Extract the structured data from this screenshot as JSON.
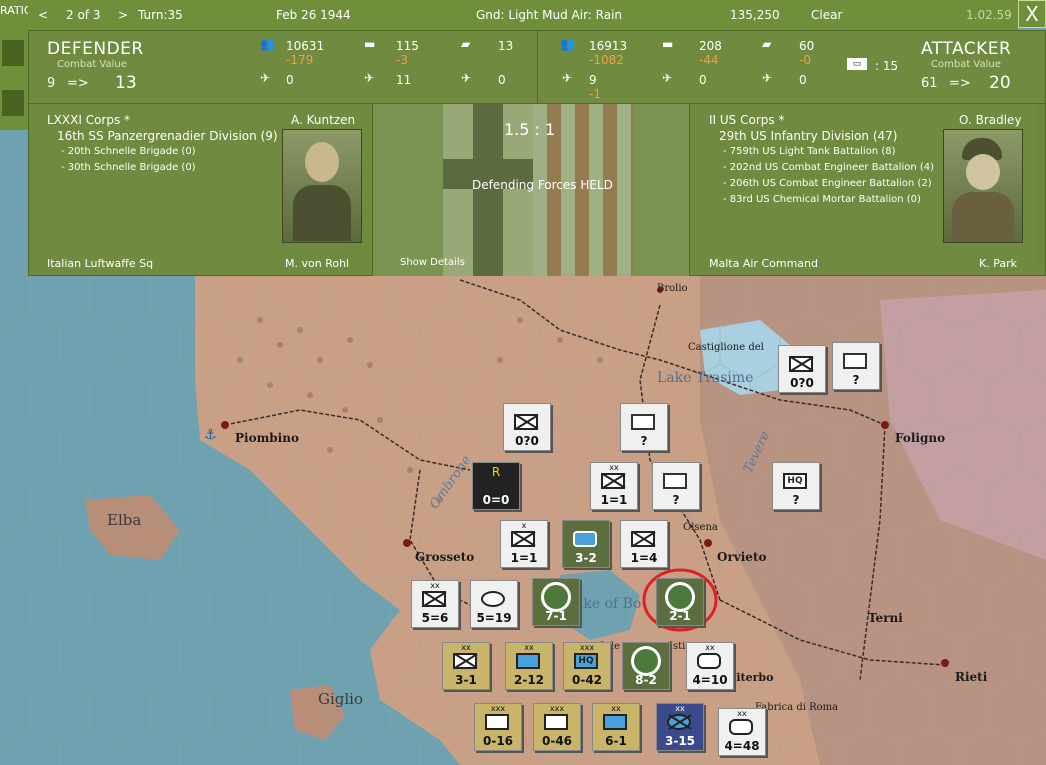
{
  "topbar": {
    "prev_arrow": "<",
    "page": "2 of 3",
    "next_arrow": ">",
    "turn": "Turn:35",
    "date": "Feb 26 1944",
    "ground": "Gnd: Light Mud  Air: Rain",
    "score": "135,250",
    "weather": "Clear",
    "version": "1.02.59",
    "close": "X",
    "left_cut": "RATIO"
  },
  "defender": {
    "title": "DEFENDER",
    "cv_label": "Combat Value",
    "cv_from": "9",
    "arrow": "=>",
    "cv_to": "13",
    "men": "10631",
    "men_loss": "-179",
    "guns": "115",
    "guns_loss": "-3",
    "afv": "13",
    "fighters": "0",
    "bombers": "11",
    "transports": "0",
    "corps": "LXXXI Corps *",
    "leader": "A. Kuntzen",
    "division": "16th SS Panzergrenadier Division (9)",
    "units": [
      "- 20th Schnelle Brigade (0)",
      "- 30th Schnelle Brigade (0)"
    ],
    "air_cmd": "Italian Luftwaffe Sq",
    "air_leader": "M. von Rohl"
  },
  "attacker": {
    "title": "ATTACKER",
    "cv_label": "Combat Value",
    "cv_from": "61",
    "arrow": "=>",
    "cv_to": "20",
    "men": "16913",
    "men_loss": "-1082",
    "guns": "208",
    "guns_loss": "-44",
    "afv": "60",
    "afv_loss": "-0",
    "fighters": "9",
    "fighters_loss": "-1",
    "bombers": "0",
    "transports": "0",
    "forts": ": 15",
    "corps": "II US Corps *",
    "leader": "O. Bradley",
    "division": "29th US Infantry Division (47)",
    "units": [
      "- 759th US Light Tank Battalion (8)",
      "- 202nd US Combat Engineer Battalion (4)",
      "- 206th US Combat Engineer Battalion (2)",
      "- 83rd US Chemical Mortar Battalion (0)"
    ],
    "air_cmd": "Malta Air Command",
    "air_leader": "K. Park"
  },
  "battle": {
    "odds": "1.5 : 1",
    "result": "Defending Forces HELD",
    "details": "Show Details"
  },
  "map": {
    "towns": [
      "Brolio",
      "Castiglione del",
      "Piombino",
      "Foligno",
      "Grosseto",
      "Orvieto",
      "Terni",
      "Rieti",
      "Olsena",
      "Orle",
      "Viterbo",
      "Fabrica di Roma",
      "Isti"
    ],
    "islands": [
      "Elba",
      "Giglio"
    ],
    "lakes": [
      "Lake Trasime",
      "ake of Bo"
    ],
    "rivers": [
      "Ombrone",
      "Tevere"
    ]
  },
  "counters": [
    {
      "label": "0?0",
      "ech": ""
    },
    {
      "label": "?",
      "ech": ""
    },
    {
      "label": "0?0",
      "ech": ""
    },
    {
      "label": "?",
      "ech": ""
    },
    {
      "label": "?",
      "ech": ""
    },
    {
      "label": "0=0",
      "ech": "R"
    },
    {
      "label": "1=1",
      "ech": "xx"
    },
    {
      "label": "?",
      "ech": ""
    },
    {
      "label": "?",
      "ech": "HQ"
    },
    {
      "label": "1=1",
      "ech": "x"
    },
    {
      "label": "3-2",
      "ech": ""
    },
    {
      "label": "1=4",
      "ech": ""
    },
    {
      "label": "5=6",
      "ech": "xx"
    },
    {
      "label": "5=19",
      "ech": ""
    },
    {
      "label": "7-1",
      "ech": ""
    },
    {
      "label": "2-1",
      "ech": ""
    },
    {
      "label": "3-1",
      "ech": "xx"
    },
    {
      "label": "2-12",
      "ech": "xx"
    },
    {
      "label": "0-42",
      "ech": "xxx"
    },
    {
      "label": "8-2",
      "ech": ""
    },
    {
      "label": "4=10",
      "ech": "xx"
    },
    {
      "label": "0-16",
      "ech": "xxx"
    },
    {
      "label": "0-46",
      "ech": "xxx"
    },
    {
      "label": "6-1",
      "ech": "xx"
    },
    {
      "label": "3-15",
      "ech": "xx"
    },
    {
      "label": "4=48",
      "ech": "xx"
    }
  ],
  "colors": {
    "panel": "#708a40",
    "sea": "#6fa2b0",
    "land": "#c9a085",
    "highlight": "#e02020"
  }
}
